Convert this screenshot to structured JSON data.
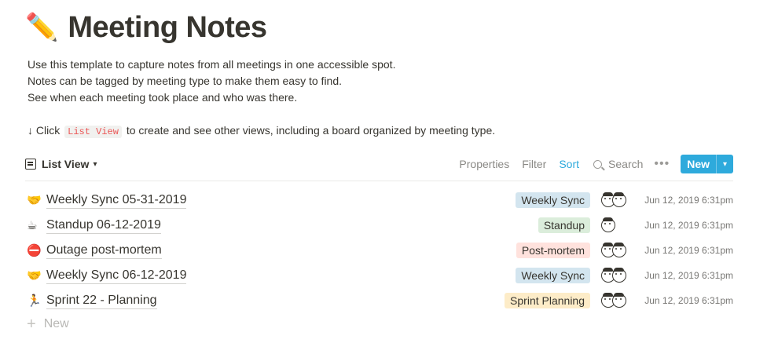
{
  "page": {
    "title_emoji": "✏️",
    "title": "Meeting Notes",
    "description": [
      "Use this template to capture notes from all meetings in one accessible spot.",
      "Notes can be tagged by meeting type to make them easy to find.",
      "See when each meeting took place and who was there."
    ],
    "hint_prefix": "↓ Click",
    "hint_code": "List View",
    "hint_suffix": "to create and see other views, including a board organized by meeting type."
  },
  "toolbar": {
    "view_label": "List View",
    "view_icon": "list-icon",
    "properties": "Properties",
    "filter": "Filter",
    "sort": "Sort",
    "search": "Search",
    "more": "•••",
    "new": "New",
    "new_caret": "⌄"
  },
  "rows": [
    {
      "icon": "🤝",
      "name": "Weekly Sync 05-31-2019",
      "tag": "Weekly Sync",
      "tag_color": "#d3e5ef",
      "people": 2,
      "date": "Jun 12, 2019 6:31pm"
    },
    {
      "icon": "☕",
      "name": "Standup 06-12-2019",
      "tag": "Standup",
      "tag_color": "#dbeddb",
      "people": 1,
      "date": "Jun 12, 2019 6:31pm"
    },
    {
      "icon": "⛔",
      "name": "Outage post-mortem",
      "tag": "Post-mortem",
      "tag_color": "#ffe2dd",
      "people": 2,
      "date": "Jun 12, 2019 6:31pm"
    },
    {
      "icon": "🤝",
      "name": "Weekly Sync 06-12-2019",
      "tag": "Weekly Sync",
      "tag_color": "#d3e5ef",
      "people": 2,
      "date": "Jun 12, 2019 6:31pm"
    },
    {
      "icon": "🏃",
      "name": "Sprint 22 - Planning",
      "tag": "Sprint Planning",
      "tag_color": "#fdecc8",
      "people": 2,
      "date": "Jun 12, 2019 6:31pm"
    }
  ],
  "add_new": {
    "icon": "+",
    "label": "New"
  },
  "colors": {
    "accent": "#2eaadc",
    "text": "#37352f",
    "muted": "#8a8985"
  }
}
